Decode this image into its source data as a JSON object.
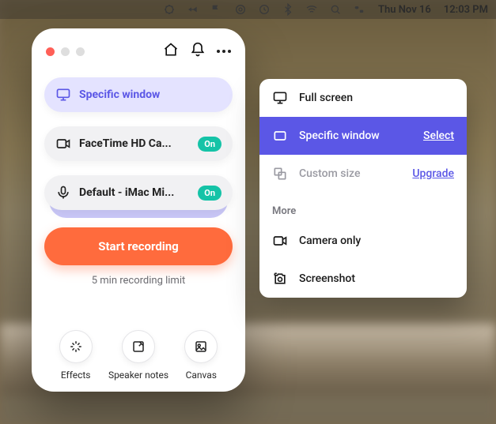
{
  "menubar": {
    "date": "Thu Nov 16",
    "time": "12:03 PM"
  },
  "panel": {
    "screen_chip": {
      "label": "Specific window"
    },
    "camera_chip": {
      "label": "FaceTime HD Ca...",
      "badge": "On"
    },
    "mic_chip": {
      "label": "Default - iMac Mi...",
      "badge": "On"
    },
    "record_button": "Start recording",
    "limit_text": "5 min recording limit",
    "tools": {
      "effects": "Effects",
      "notes": "Speaker notes",
      "canvas": "Canvas"
    }
  },
  "submenu": {
    "full_screen": "Full screen",
    "specific_window": "Specific window",
    "select_action": "Select",
    "custom_size": "Custom size",
    "upgrade_action": "Upgrade",
    "more_header": "More",
    "camera_only": "Camera only",
    "screenshot": "Screenshot"
  },
  "colors": {
    "accent": "#5b57e6",
    "record": "#ff6b3d",
    "badge": "#15c3a7"
  }
}
